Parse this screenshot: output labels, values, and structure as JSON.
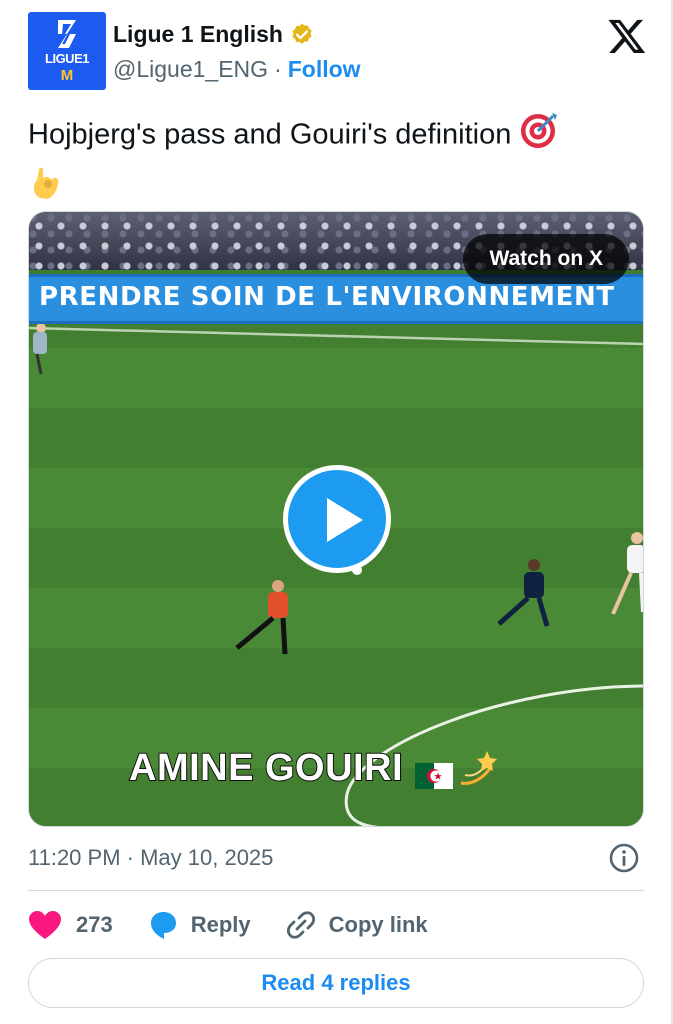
{
  "account": {
    "display_name": "Ligue 1 English",
    "handle": "@Ligue1_ENG",
    "separator": "·",
    "follow_label": "Follow",
    "avatar_text": "LIGUE1",
    "avatar_mc": "M",
    "verified_icon": "verified-badge-icon"
  },
  "platform_logo": "x-logo-icon",
  "tweet": {
    "text": "Hojbjerg's pass and Gouiri's definition",
    "emojis": [
      "🎯",
      "👌"
    ]
  },
  "media": {
    "watch_label": "Watch on X",
    "board_text": "PRENDRE SOIN DE L'ENVIRONNEMENT",
    "caption": "AMINE GOUIRI",
    "caption_emojis": [
      "🇩🇿",
      "💫"
    ],
    "play_icon": "play-icon"
  },
  "meta": {
    "timestamp": "11:20 PM · May 10, 2025",
    "info_icon": "info-icon"
  },
  "actions": {
    "like_count": "273",
    "reply_label": "Reply",
    "copy_label": "Copy link"
  },
  "replies_button": "Read 4 replies",
  "colors": {
    "accent": "#1d9bf0",
    "link": "#1d8cf0",
    "like": "#f91880",
    "verified": "#e2b719",
    "muted": "#536471",
    "text": "#0f1419"
  }
}
